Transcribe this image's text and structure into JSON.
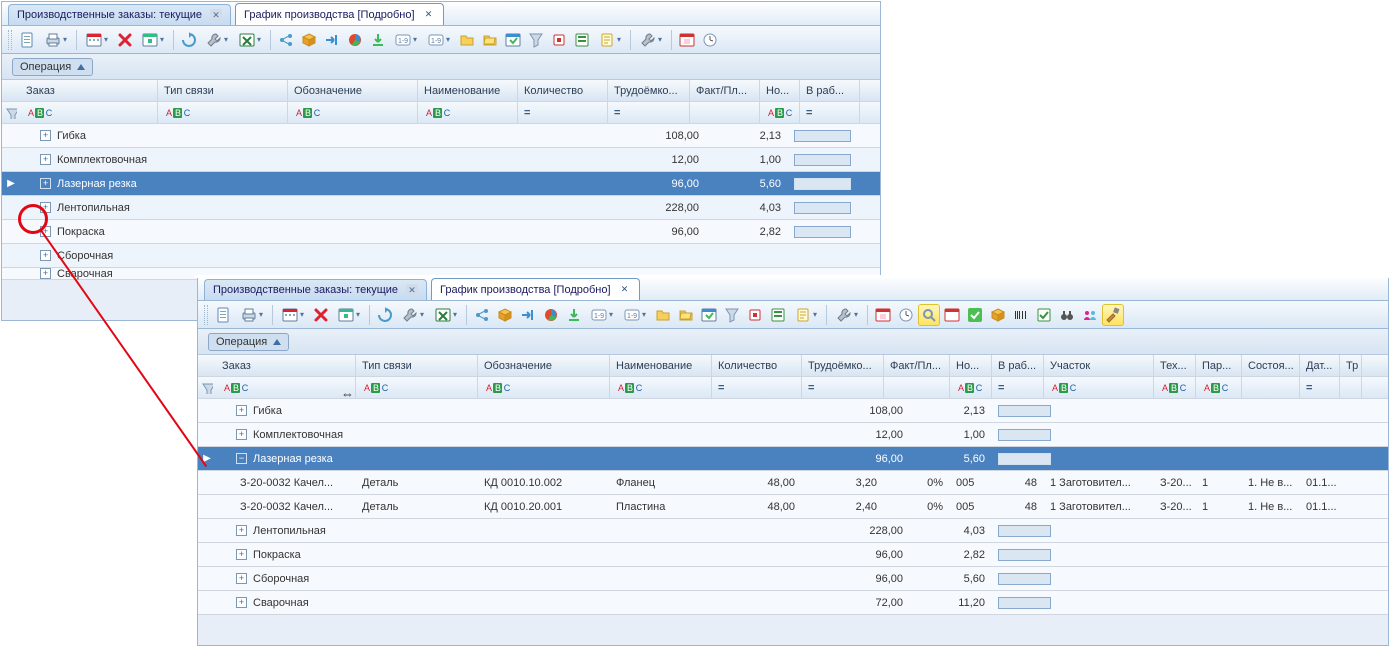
{
  "tabs": {
    "inactive_label": "Производственные заказы: текущие",
    "active_label": "График производства [Подробно]"
  },
  "group": {
    "label": "Операция"
  },
  "cols_top": {
    "c1": "Заказ",
    "c2": "Тип связи",
    "c3": "Обозначение",
    "c4": "Наименование",
    "c5": "Количество",
    "c6": "Трудоёмко...",
    "c7": "Факт/Пл...",
    "c8": "Но...",
    "c9": "В раб..."
  },
  "cols_bot": {
    "c1": "Заказ",
    "c2": "Тип связи",
    "c3": "Обозначение",
    "c4": "Наименование",
    "c5": "Количество",
    "c6": "Трудоёмко...",
    "c7": "Факт/Пл...",
    "c8": "Но...",
    "c9": "В раб...",
    "c10": "Участок",
    "c11": "Тех...",
    "c12": "Пар...",
    "c13": "Состоя...",
    "c14": "Дат...",
    "c15": "Тр"
  },
  "top_rows": [
    {
      "name": "Гибка",
      "qty": "108,00",
      "lab": "2,13"
    },
    {
      "name": "Комплектовочная",
      "qty": "12,00",
      "lab": "1,00"
    },
    {
      "name": "Лазерная резка",
      "qty": "96,00",
      "lab": "5,60",
      "sel": true
    },
    {
      "name": "Лентопильная",
      "qty": "228,00",
      "lab": "4,03"
    },
    {
      "name": "Покраска",
      "qty": "96,00",
      "lab": "2,82"
    },
    {
      "name": "Сборочная",
      "qty": "",
      "lab": ""
    },
    {
      "name": "Сварочная",
      "qty": "",
      "lab": "",
      "cut": true
    }
  ],
  "bot_groups": [
    {
      "name": "Гибка",
      "qty": "108,00",
      "lab": "2,13",
      "exp": "+"
    },
    {
      "name": "Комплектовочная",
      "qty": "12,00",
      "lab": "1,00",
      "exp": "+"
    },
    {
      "name": "Лазерная резка",
      "qty": "96,00",
      "lab": "5,60",
      "exp": "−",
      "sel": true
    }
  ],
  "bot_children": [
    {
      "order": "З-20-0032 Качел...",
      "type": "Деталь",
      "obj": "КД 0010.10.002",
      "nm": "Фланец",
      "qty": "48,00",
      "lab": "3,20",
      "fact": "0%",
      "no": "005",
      "work": "48",
      "uch": "1 Заготовител...",
      "tex": "З-20...",
      "par": "1",
      "sost": "1. Не в...",
      "dat": "01.1..."
    },
    {
      "order": "З-20-0032 Качел...",
      "type": "Деталь",
      "obj": "КД 0010.20.001",
      "nm": "Пластина",
      "qty": "48,00",
      "lab": "2,40",
      "fact": "0%",
      "no": "005",
      "work": "48",
      "uch": "1 Заготовител...",
      "tex": "З-20...",
      "par": "1",
      "sost": "1. Не в...",
      "dat": "01.1..."
    }
  ],
  "bot_tail": [
    {
      "name": "Лентопильная",
      "qty": "228,00",
      "lab": "4,03"
    },
    {
      "name": "Покраска",
      "qty": "96,00",
      "lab": "2,82"
    },
    {
      "name": "Сборочная",
      "qty": "96,00",
      "lab": "5,60"
    },
    {
      "name": "Сварочная",
      "qty": "72,00",
      "lab": "11,20"
    }
  ],
  "icons": {
    "arrow": "⇔"
  }
}
